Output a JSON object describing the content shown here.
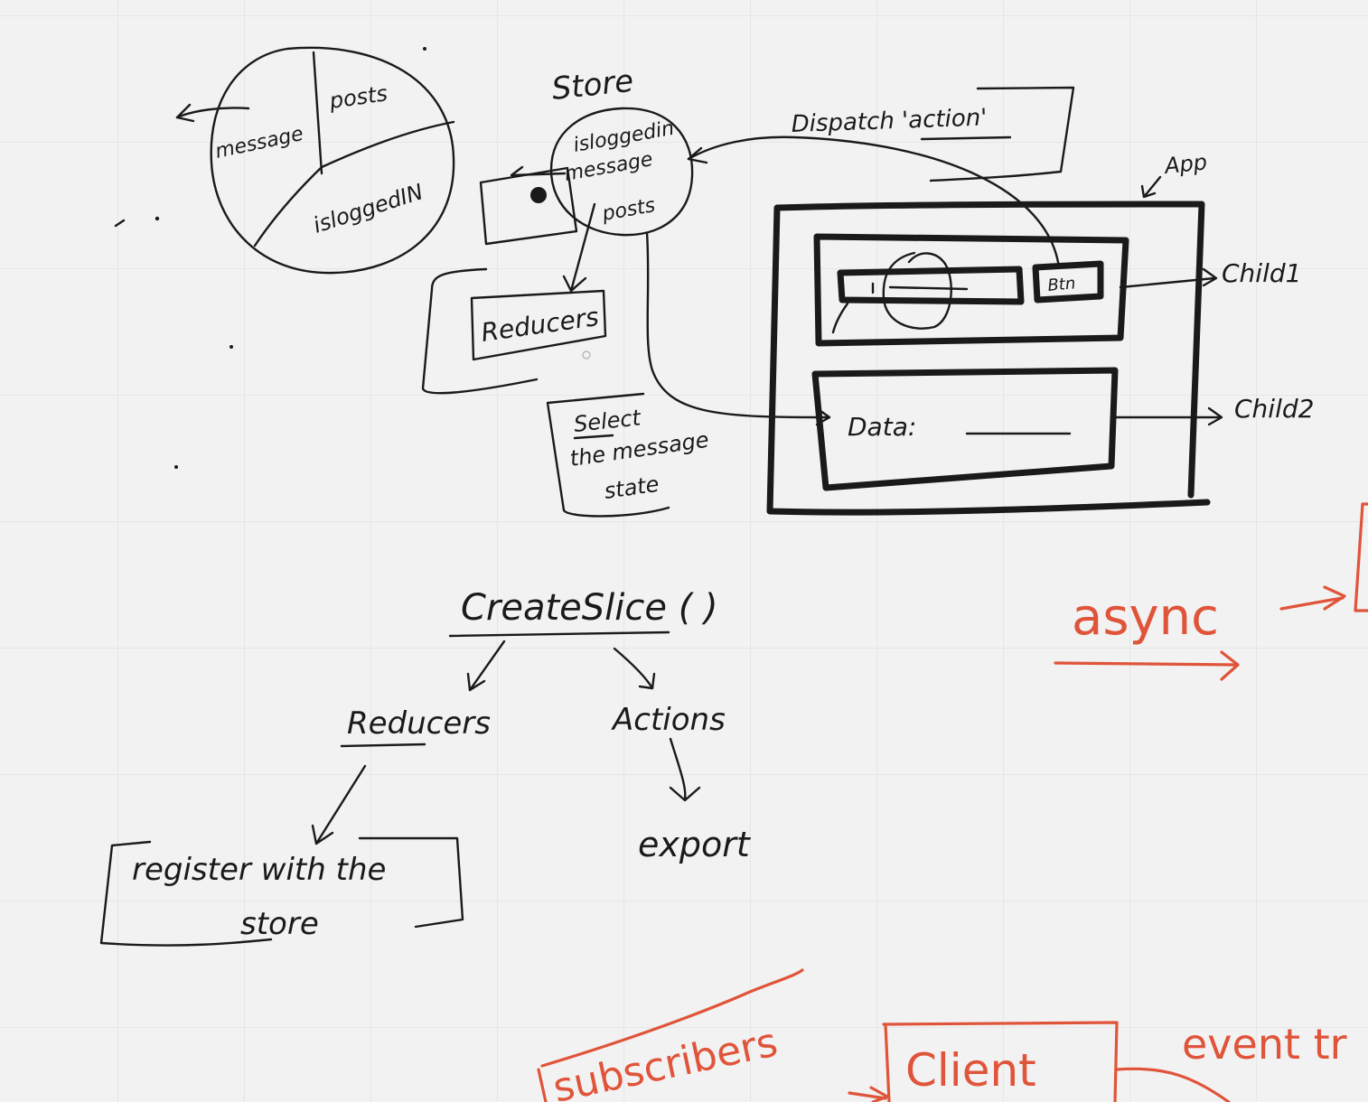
{
  "pie": {
    "slices": [
      "posts",
      "message",
      "isloggedIN"
    ]
  },
  "store": {
    "title": "Store",
    "items": [
      "isloggedin",
      "message",
      "posts"
    ]
  },
  "reducers_box": "Reducers",
  "dispatch_label": "Dispatch 'action'",
  "app_label": "App",
  "btn_label": "Btn",
  "child1_label": "Child1",
  "child2_label": "Child2",
  "data_label": "Data:",
  "select_note": [
    "Select",
    "the message",
    "state"
  ],
  "createslice": {
    "title": "CreateSlice ( )",
    "left": "Reducers",
    "right": "Actions",
    "export": "export",
    "register": [
      "register with the",
      "store"
    ]
  },
  "async_label": "async",
  "subscribers_label": "subscribers",
  "client_label": "Client",
  "event_label": "event tr",
  "colors": {
    "ink": "#1a1a1a",
    "accent": "#e0543a",
    "background": "#f2f2f2"
  }
}
